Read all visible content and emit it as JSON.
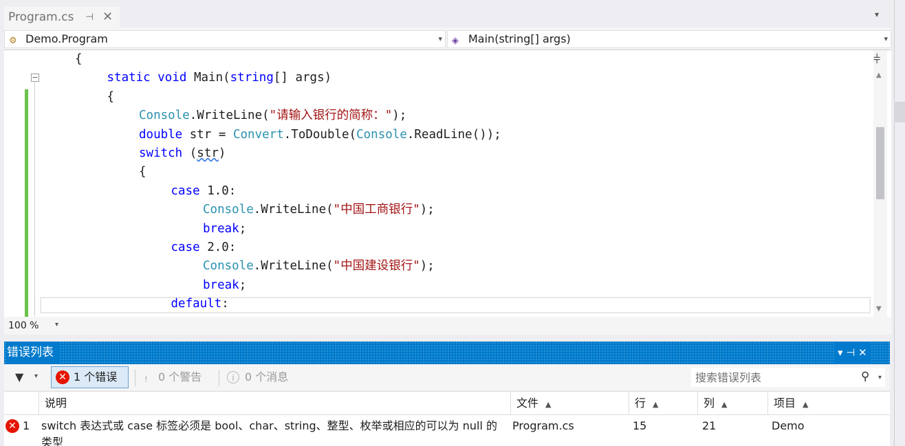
{
  "tab": {
    "title": "Program.cs",
    "pin": "⊣",
    "close": "✕"
  },
  "nav": {
    "class_scope": "Demo.Program",
    "member_scope": "Main(string[] args)"
  },
  "editor": {
    "lines": [
      {
        "indent": 2,
        "parts": [
          {
            "t": "{",
            "c": ""
          }
        ]
      },
      {
        "indent": 3,
        "parts": [
          {
            "t": "static",
            "c": "kw"
          },
          {
            "t": " ",
            "c": ""
          },
          {
            "t": "void",
            "c": "kw"
          },
          {
            "t": " Main(",
            "c": ""
          },
          {
            "t": "string",
            "c": "kw"
          },
          {
            "t": "[] args)",
            "c": ""
          }
        ]
      },
      {
        "indent": 3,
        "parts": [
          {
            "t": "{",
            "c": ""
          }
        ]
      },
      {
        "indent": 4,
        "parts": [
          {
            "t": "Console",
            "c": "ty"
          },
          {
            "t": ".WriteLine(",
            "c": ""
          },
          {
            "t": "\"请输入银行的简称：\"",
            "c": "st"
          },
          {
            "t": ");",
            "c": ""
          }
        ]
      },
      {
        "indent": 4,
        "parts": [
          {
            "t": "double",
            "c": "kw"
          },
          {
            "t": " str = ",
            "c": ""
          },
          {
            "t": "Convert",
            "c": "ty"
          },
          {
            "t": ".ToDouble(",
            "c": ""
          },
          {
            "t": "Console",
            "c": "ty"
          },
          {
            "t": ".ReadLine());",
            "c": ""
          }
        ]
      },
      {
        "indent": 4,
        "parts": [
          {
            "t": "switch",
            "c": "kw"
          },
          {
            "t": " (",
            "c": ""
          },
          {
            "t": "str",
            "c": "squig"
          },
          {
            "t": ")",
            "c": ""
          }
        ]
      },
      {
        "indent": 4,
        "parts": [
          {
            "t": "{",
            "c": ""
          }
        ]
      },
      {
        "indent": 5,
        "parts": [
          {
            "t": "case",
            "c": "kw"
          },
          {
            "t": " 1.0:",
            "c": ""
          }
        ]
      },
      {
        "indent": 6,
        "parts": [
          {
            "t": "Console",
            "c": "ty"
          },
          {
            "t": ".WriteLine(",
            "c": ""
          },
          {
            "t": "\"中国工商银行\"",
            "c": "st"
          },
          {
            "t": ");",
            "c": ""
          }
        ]
      },
      {
        "indent": 6,
        "parts": [
          {
            "t": "break",
            "c": "kw"
          },
          {
            "t": ";",
            "c": ""
          }
        ]
      },
      {
        "indent": 5,
        "parts": [
          {
            "t": "case",
            "c": "kw"
          },
          {
            "t": " 2.0:",
            "c": ""
          }
        ]
      },
      {
        "indent": 6,
        "parts": [
          {
            "t": "Console",
            "c": "ty"
          },
          {
            "t": ".WriteLine(",
            "c": ""
          },
          {
            "t": "\"中国建设银行\"",
            "c": "st"
          },
          {
            "t": ");",
            "c": ""
          }
        ]
      },
      {
        "indent": 6,
        "parts": [
          {
            "t": "break",
            "c": "kw"
          },
          {
            "t": ";",
            "c": ""
          }
        ]
      },
      {
        "indent": 5,
        "parts": [
          {
            "t": "default",
            "c": "kw"
          },
          {
            "t": ":",
            "c": ""
          }
        ]
      }
    ]
  },
  "zoom": {
    "level": "100 %"
  },
  "error_list": {
    "title": "错误列表",
    "window_buttons": "▾  ⊣  ✕",
    "errors_toggle": "1 个错误",
    "warnings_toggle": "0 个警告",
    "messages_toggle": "0 个消息",
    "search_placeholder": "搜索错误列表",
    "columns": {
      "desc": "说明",
      "file": "文件",
      "line": "行",
      "col": "列",
      "project": "项目"
    },
    "sort_glyph": "▲",
    "rows": [
      {
        "num": "1",
        "desc": "switch 表达式或 case 标签必须是 bool、char、string、整型、枚举或相应的可以为 null 的类型",
        "file": "Program.cs",
        "line": "15",
        "col": "21",
        "project": "Demo"
      }
    ]
  },
  "colors": {
    "accent": "#007acc",
    "error": "#e51400",
    "keyword": "#0000ff",
    "type": "#2b91af",
    "string": "#a31515"
  }
}
